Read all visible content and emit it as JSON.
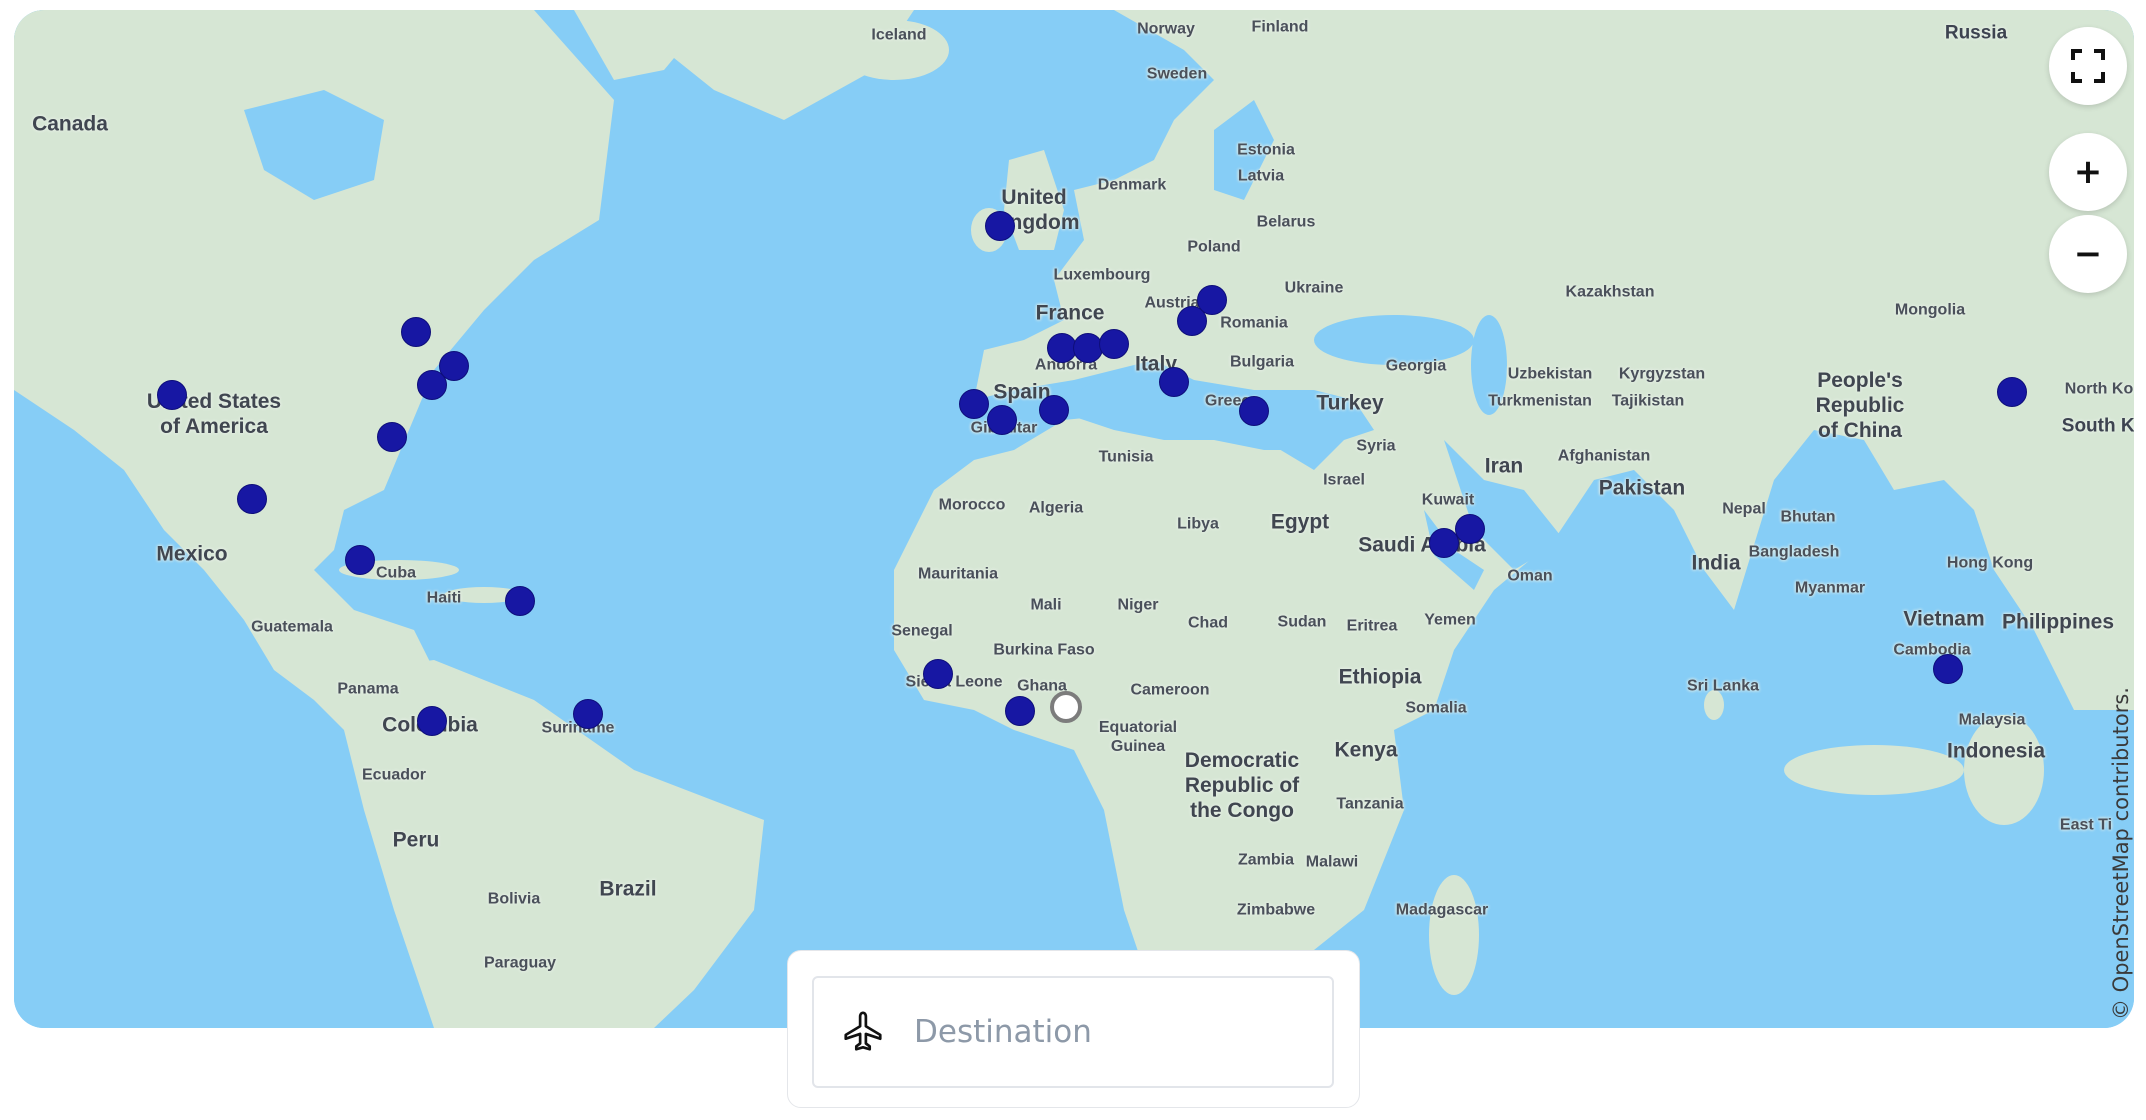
{
  "map": {
    "country_labels": [
      {
        "id": "canada",
        "text": "Canada",
        "cls": "big"
      },
      {
        "id": "usa",
        "text": "United States\nof America",
        "cls": "big"
      },
      {
        "id": "mexico",
        "text": "Mexico",
        "cls": "big"
      },
      {
        "id": "cuba",
        "text": "Cuba",
        "cls": "sm"
      },
      {
        "id": "haiti",
        "text": "Haiti",
        "cls": "sm"
      },
      {
        "id": "guatemala",
        "text": "Guatemala",
        "cls": "sm"
      },
      {
        "id": "panama",
        "text": "Panama",
        "cls": "sm"
      },
      {
        "id": "colombia",
        "text": "Colombia",
        "cls": "big"
      },
      {
        "id": "suriname",
        "text": "Suriname",
        "cls": "sm"
      },
      {
        "id": "ecuador",
        "text": "Ecuador",
        "cls": "sm"
      },
      {
        "id": "peru",
        "text": "Peru",
        "cls": "big"
      },
      {
        "id": "brazil",
        "text": "Brazil",
        "cls": "big"
      },
      {
        "id": "bolivia",
        "text": "Bolivia",
        "cls": "sm"
      },
      {
        "id": "paraguay",
        "text": "Paraguay",
        "cls": "sm"
      },
      {
        "id": "iceland",
        "text": "Iceland",
        "cls": "sm"
      },
      {
        "id": "norway",
        "text": "Norway",
        "cls": "sm"
      },
      {
        "id": "sweden",
        "text": "Sweden",
        "cls": "sm"
      },
      {
        "id": "finland",
        "text": "Finland",
        "cls": "sm"
      },
      {
        "id": "russia",
        "text": "Russia",
        "cls": "mid"
      },
      {
        "id": "estonia",
        "text": "Estonia",
        "cls": "sm"
      },
      {
        "id": "latvia",
        "text": "Latvia",
        "cls": "sm"
      },
      {
        "id": "denmark",
        "text": "Denmark",
        "cls": "sm"
      },
      {
        "id": "uk",
        "text": "United\nKingdom",
        "cls": "big"
      },
      {
        "id": "belarus",
        "text": "Belarus",
        "cls": "sm"
      },
      {
        "id": "poland",
        "text": "Poland",
        "cls": "sm"
      },
      {
        "id": "luxembourg",
        "text": "Luxembourg",
        "cls": "sm"
      },
      {
        "id": "ukraine",
        "text": "Ukraine",
        "cls": "sm"
      },
      {
        "id": "france",
        "text": "France",
        "cls": "big"
      },
      {
        "id": "austria",
        "text": "Austria",
        "cls": "sm"
      },
      {
        "id": "romania",
        "text": "Romania",
        "cls": "sm"
      },
      {
        "id": "andorra",
        "text": "Andorra",
        "cls": "sm"
      },
      {
        "id": "italy",
        "text": "Italy",
        "cls": "big"
      },
      {
        "id": "bulgaria",
        "text": "Bulgaria",
        "cls": "sm"
      },
      {
        "id": "spain",
        "text": "Spain",
        "cls": "big"
      },
      {
        "id": "gibraltar",
        "text": "Gibraltar",
        "cls": "sm"
      },
      {
        "id": "greece",
        "text": "Greece",
        "cls": "sm"
      },
      {
        "id": "turkey",
        "text": "Turkey",
        "cls": "big"
      },
      {
        "id": "georgia",
        "text": "Georgia",
        "cls": "sm"
      },
      {
        "id": "kazakhstan",
        "text": "Kazakhstan",
        "cls": "sm"
      },
      {
        "id": "mongolia",
        "text": "Mongolia",
        "cls": "sm"
      },
      {
        "id": "uzbekistan",
        "text": "Uzbekistan",
        "cls": "sm"
      },
      {
        "id": "kyrgyzstan",
        "text": "Kyrgyzstan",
        "cls": "sm"
      },
      {
        "id": "turkmenistan",
        "text": "Turkmenistan",
        "cls": "sm"
      },
      {
        "id": "tajikistan",
        "text": "Tajikistan",
        "cls": "sm"
      },
      {
        "id": "china",
        "text": "People's\nRepublic\nof China",
        "cls": "big"
      },
      {
        "id": "north_korea",
        "text": "North Ko",
        "cls": "sm"
      },
      {
        "id": "south_korea",
        "text": "South Ko",
        "cls": "mid"
      },
      {
        "id": "tunisia",
        "text": "Tunisia",
        "cls": "sm"
      },
      {
        "id": "syria",
        "text": "Syria",
        "cls": "sm"
      },
      {
        "id": "israel",
        "text": "Israel",
        "cls": "sm"
      },
      {
        "id": "iran",
        "text": "Iran",
        "cls": "big"
      },
      {
        "id": "afghanistan",
        "text": "Afghanistan",
        "cls": "sm"
      },
      {
        "id": "pakistan",
        "text": "Pakistan",
        "cls": "big"
      },
      {
        "id": "morocco",
        "text": "Morocco",
        "cls": "sm"
      },
      {
        "id": "algeria",
        "text": "Algeria",
        "cls": "sm"
      },
      {
        "id": "libya",
        "text": "Libya",
        "cls": "sm"
      },
      {
        "id": "egypt",
        "text": "Egypt",
        "cls": "big"
      },
      {
        "id": "kuwait",
        "text": "Kuwait",
        "cls": "sm"
      },
      {
        "id": "nepal",
        "text": "Nepal",
        "cls": "sm"
      },
      {
        "id": "bhutan",
        "text": "Bhutan",
        "cls": "sm"
      },
      {
        "id": "saudi",
        "text": "Saudi Arabia",
        "cls": "big"
      },
      {
        "id": "bangladesh",
        "text": "Bangladesh",
        "cls": "sm"
      },
      {
        "id": "india",
        "text": "India",
        "cls": "big"
      },
      {
        "id": "hong_kong",
        "text": "Hong Kong",
        "cls": "sm"
      },
      {
        "id": "mauritania",
        "text": "Mauritania",
        "cls": "sm"
      },
      {
        "id": "oman",
        "text": "Oman",
        "cls": "sm"
      },
      {
        "id": "myanmar",
        "text": "Myanmar",
        "cls": "sm"
      },
      {
        "id": "mali",
        "text": "Mali",
        "cls": "sm"
      },
      {
        "id": "niger",
        "text": "Niger",
        "cls": "sm"
      },
      {
        "id": "chad",
        "text": "Chad",
        "cls": "sm"
      },
      {
        "id": "sudan",
        "text": "Sudan",
        "cls": "sm"
      },
      {
        "id": "eritrea",
        "text": "Eritrea",
        "cls": "sm"
      },
      {
        "id": "yemen",
        "text": "Yemen",
        "cls": "sm"
      },
      {
        "id": "vietnam",
        "text": "Vietnam",
        "cls": "big"
      },
      {
        "id": "philippines",
        "text": "Philippines",
        "cls": "big"
      },
      {
        "id": "senegal",
        "text": "Senegal",
        "cls": "sm"
      },
      {
        "id": "burkina",
        "text": "Burkina Faso",
        "cls": "sm"
      },
      {
        "id": "cambodia",
        "text": "Cambodia",
        "cls": "sm"
      },
      {
        "id": "ethiopia",
        "text": "Ethiopia",
        "cls": "big"
      },
      {
        "id": "sierra_leone",
        "text": "Sierra Leone",
        "cls": "sm"
      },
      {
        "id": "ghana",
        "text": "Ghana",
        "cls": "sm"
      },
      {
        "id": "sri_lanka",
        "text": "Sri Lanka",
        "cls": "sm"
      },
      {
        "id": "cameroon",
        "text": "Cameroon",
        "cls": "sm"
      },
      {
        "id": "somalia",
        "text": "Somalia",
        "cls": "sm"
      },
      {
        "id": "malaysia",
        "text": "Malaysia",
        "cls": "sm"
      },
      {
        "id": "eq_guinea",
        "text": "Equatorial\nGuinea",
        "cls": "sm"
      },
      {
        "id": "kenya",
        "text": "Kenya",
        "cls": "big"
      },
      {
        "id": "indonesia",
        "text": "Indonesia",
        "cls": "big"
      },
      {
        "id": "drc",
        "text": "Democratic\nRepublic of\nthe Congo",
        "cls": "big"
      },
      {
        "id": "tanzania",
        "text": "Tanzania",
        "cls": "sm"
      },
      {
        "id": "east",
        "text": "East Ti",
        "cls": "sm"
      },
      {
        "id": "zambia",
        "text": "Zambia",
        "cls": "sm"
      },
      {
        "id": "malawi",
        "text": "Malawi",
        "cls": "sm"
      },
      {
        "id": "zimbabwe",
        "text": "Zimbabwe",
        "cls": "sm"
      },
      {
        "id": "madagascar",
        "text": "Madagascar",
        "cls": "sm"
      }
    ],
    "markers_count": 30
  },
  "controls": {
    "fullscreen_icon": "fullscreen-icon",
    "zoom_in_label": "+",
    "zoom_out_label": "−"
  },
  "attribution": "© OpenStreetMap contributors.",
  "search": {
    "icon": "airplane-icon",
    "placeholder": "Destination",
    "value": ""
  },
  "colors": {
    "water": "#86cdf6",
    "land": "#d6e6d4",
    "marker": "#1717a3",
    "origin_marker": "#ffffff"
  }
}
